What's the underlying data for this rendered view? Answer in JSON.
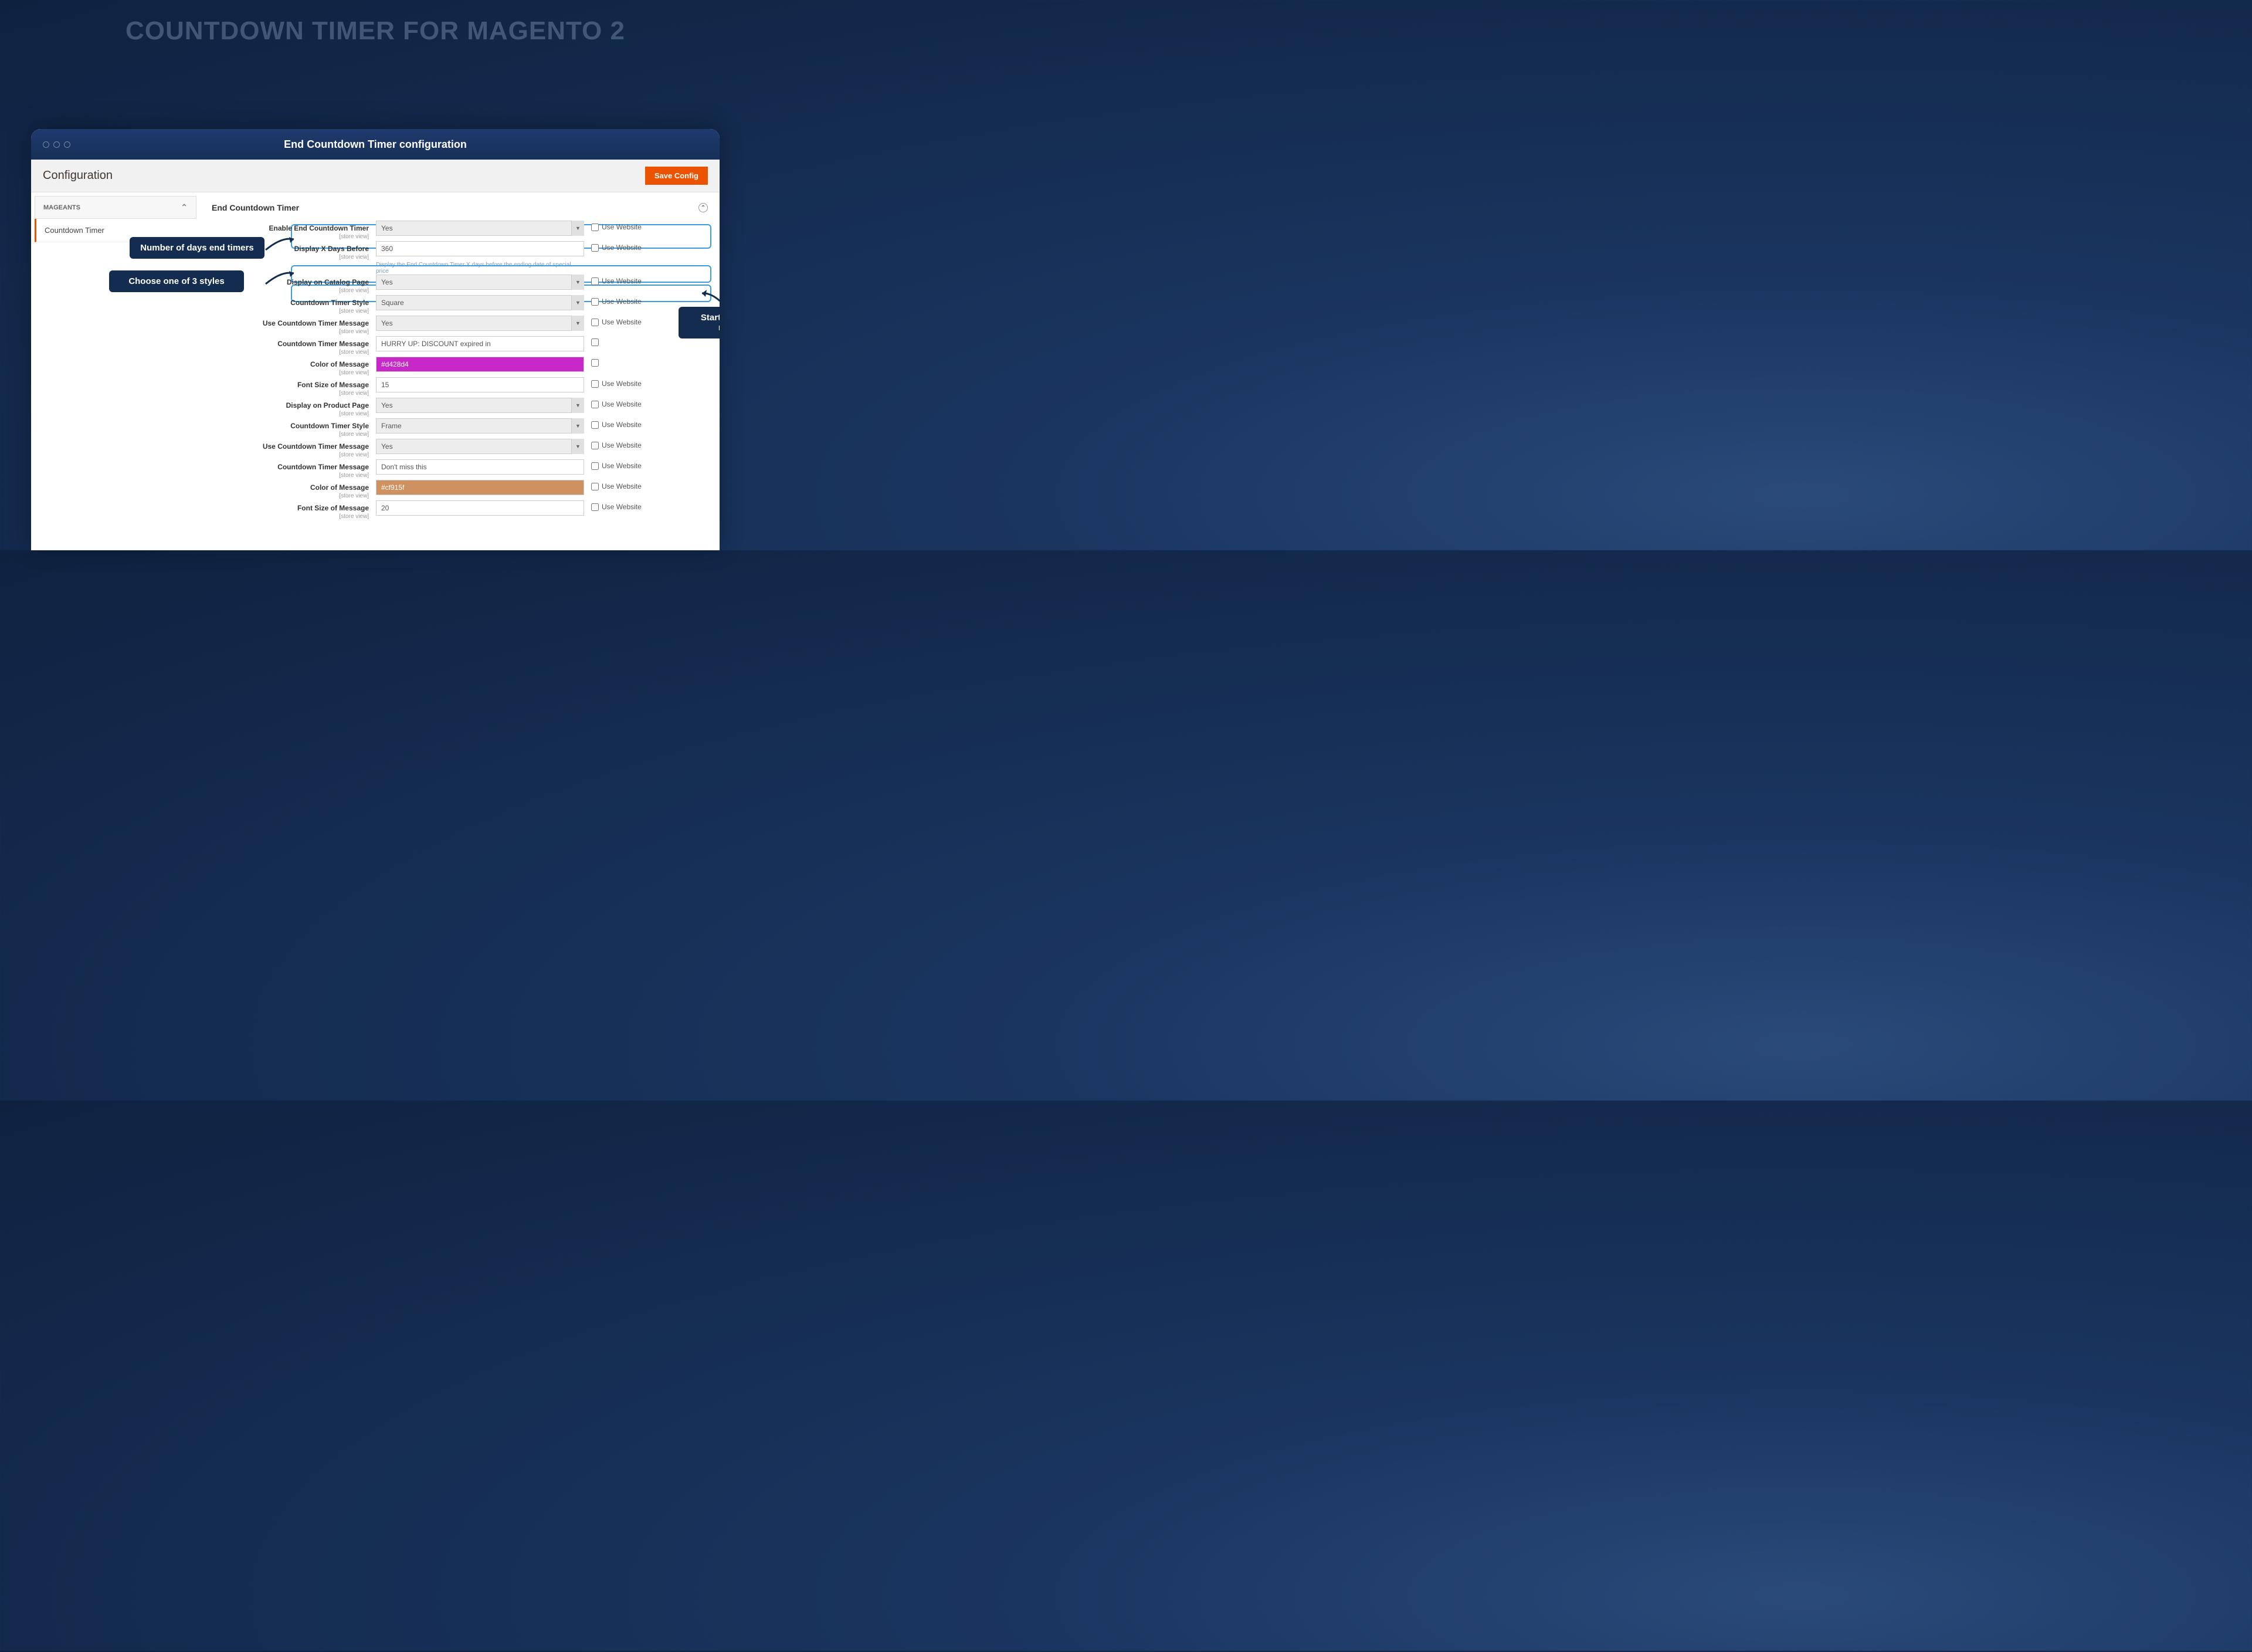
{
  "hero": {
    "title": "COUNTDOWN TIMER FOR MAGENTO 2"
  },
  "browser": {
    "title": "End Countdown Timer configuration"
  },
  "page": {
    "title": "Configuration",
    "save_button": "Save Config"
  },
  "sidebar": {
    "header": "MAGEANTS",
    "item": "Countdown Timer"
  },
  "section": {
    "title": "End Countdown Timer"
  },
  "annotations": {
    "ann1": "Number of days end timers",
    "ann2": "Choose one of 3 styles",
    "ann3": "Start to end timer message"
  },
  "fields": {
    "f1": {
      "label": "Enable End Countdown Timer",
      "scope": "[store view]",
      "value": "Yes",
      "cb": "Use Website"
    },
    "f2": {
      "label": "Display X Days Before",
      "scope": "[store view]",
      "value": "360",
      "cb": "Use Website",
      "hint": "Display the End Countdown Timer X days before the ending date of special price"
    },
    "f3": {
      "label": "Display on Catalog Page",
      "scope": "[store view]",
      "value": "Yes",
      "cb": "Use Website"
    },
    "f4": {
      "label": "Countdown Timer Style",
      "scope": "[store view]",
      "value": "Square",
      "cb": "Use Website"
    },
    "f5": {
      "label": "Use Countdown Timer Message",
      "scope": "[store view]",
      "value": "Yes",
      "cb": "Use Website"
    },
    "f6": {
      "label": "Countdown Timer Message",
      "scope": "[store view]",
      "value": "HURRY UP: DISCOUNT expired in",
      "cb": ""
    },
    "f7": {
      "label": "Color of Message",
      "scope": "[store view]",
      "value": "#d428d4",
      "cb": ""
    },
    "f8": {
      "label": "Font Size of Message",
      "scope": "[store view]",
      "value": "15",
      "cb": "Use Website"
    },
    "f9": {
      "label": "Display on Product Page",
      "scope": "[store view]",
      "value": "Yes",
      "cb": "Use Website"
    },
    "f10": {
      "label": "Countdown Timer Style",
      "scope": "[store view]",
      "value": "Frame",
      "cb": "Use Website"
    },
    "f11": {
      "label": "Use Countdown Timer Message",
      "scope": "[store view]",
      "value": "Yes",
      "cb": "Use Website"
    },
    "f12": {
      "label": "Countdown Timer Message",
      "scope": "[store view]",
      "value": "Don't miss this",
      "cb": "Use Website"
    },
    "f13": {
      "label": "Color of Message",
      "scope": "[store view]",
      "value": "#cf915f",
      "cb": "Use Website"
    },
    "f14": {
      "label": "Font Size of Message",
      "scope": "[store view]",
      "value": "20",
      "cb": "Use Website"
    }
  }
}
